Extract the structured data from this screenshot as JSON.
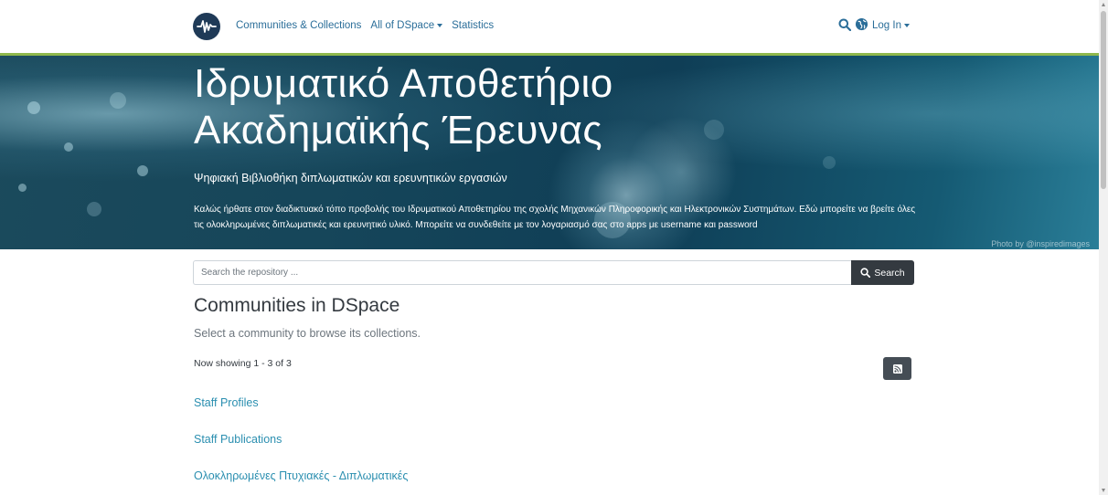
{
  "nav": {
    "communities": "Communities & Collections",
    "all_dspace": "All of DSpace",
    "statistics": "Statistics",
    "login": "Log In"
  },
  "icons": {
    "logo": "dspace-logo-icon",
    "search": "search-icon",
    "language": "globe-icon",
    "rss": "rss-icon"
  },
  "banner": {
    "title_line1": "Ιδρυματικό Αποθετήριο",
    "title_line2": "Ακαδημαϊκής Έρευνας",
    "subtitle": "Ψηφιακή Βιβλιοθήκη διπλωματικών και ερευνητικών εργασιών",
    "text": "Καλώς ήρθατε στον διαδικτυακό τόπο προβολής του Ιδρυματικού Αποθετηρίου της σχολής Μηχανικών Πληροφορικής και Ηλεκτρονικών Συστημάτων. Εδώ μπορείτε να βρείτε όλες τις ολοκληρωμένες διπλωματικές και ερευνητικό υλικό. Μπορείτε να συνδεθείτε με τον λογαριασμό σας στο apps με username και password",
    "photo_credit": "Photo by @inspiredimages"
  },
  "search": {
    "placeholder": "Search the repository ...",
    "button": "Search"
  },
  "main": {
    "heading": "Communities in DSpace",
    "lead": "Select a community to browse its collections.",
    "showing": "Now showing 1 - 3 of 3",
    "communities": [
      "Staff Profiles",
      "Staff Publications",
      "Ολοκληρωμένες Πτυχιακές - Διπλωματικές"
    ]
  },
  "colors": {
    "link": "#2b6e99",
    "accent_line": "#8fb84c",
    "dark_button": "#343a40"
  }
}
